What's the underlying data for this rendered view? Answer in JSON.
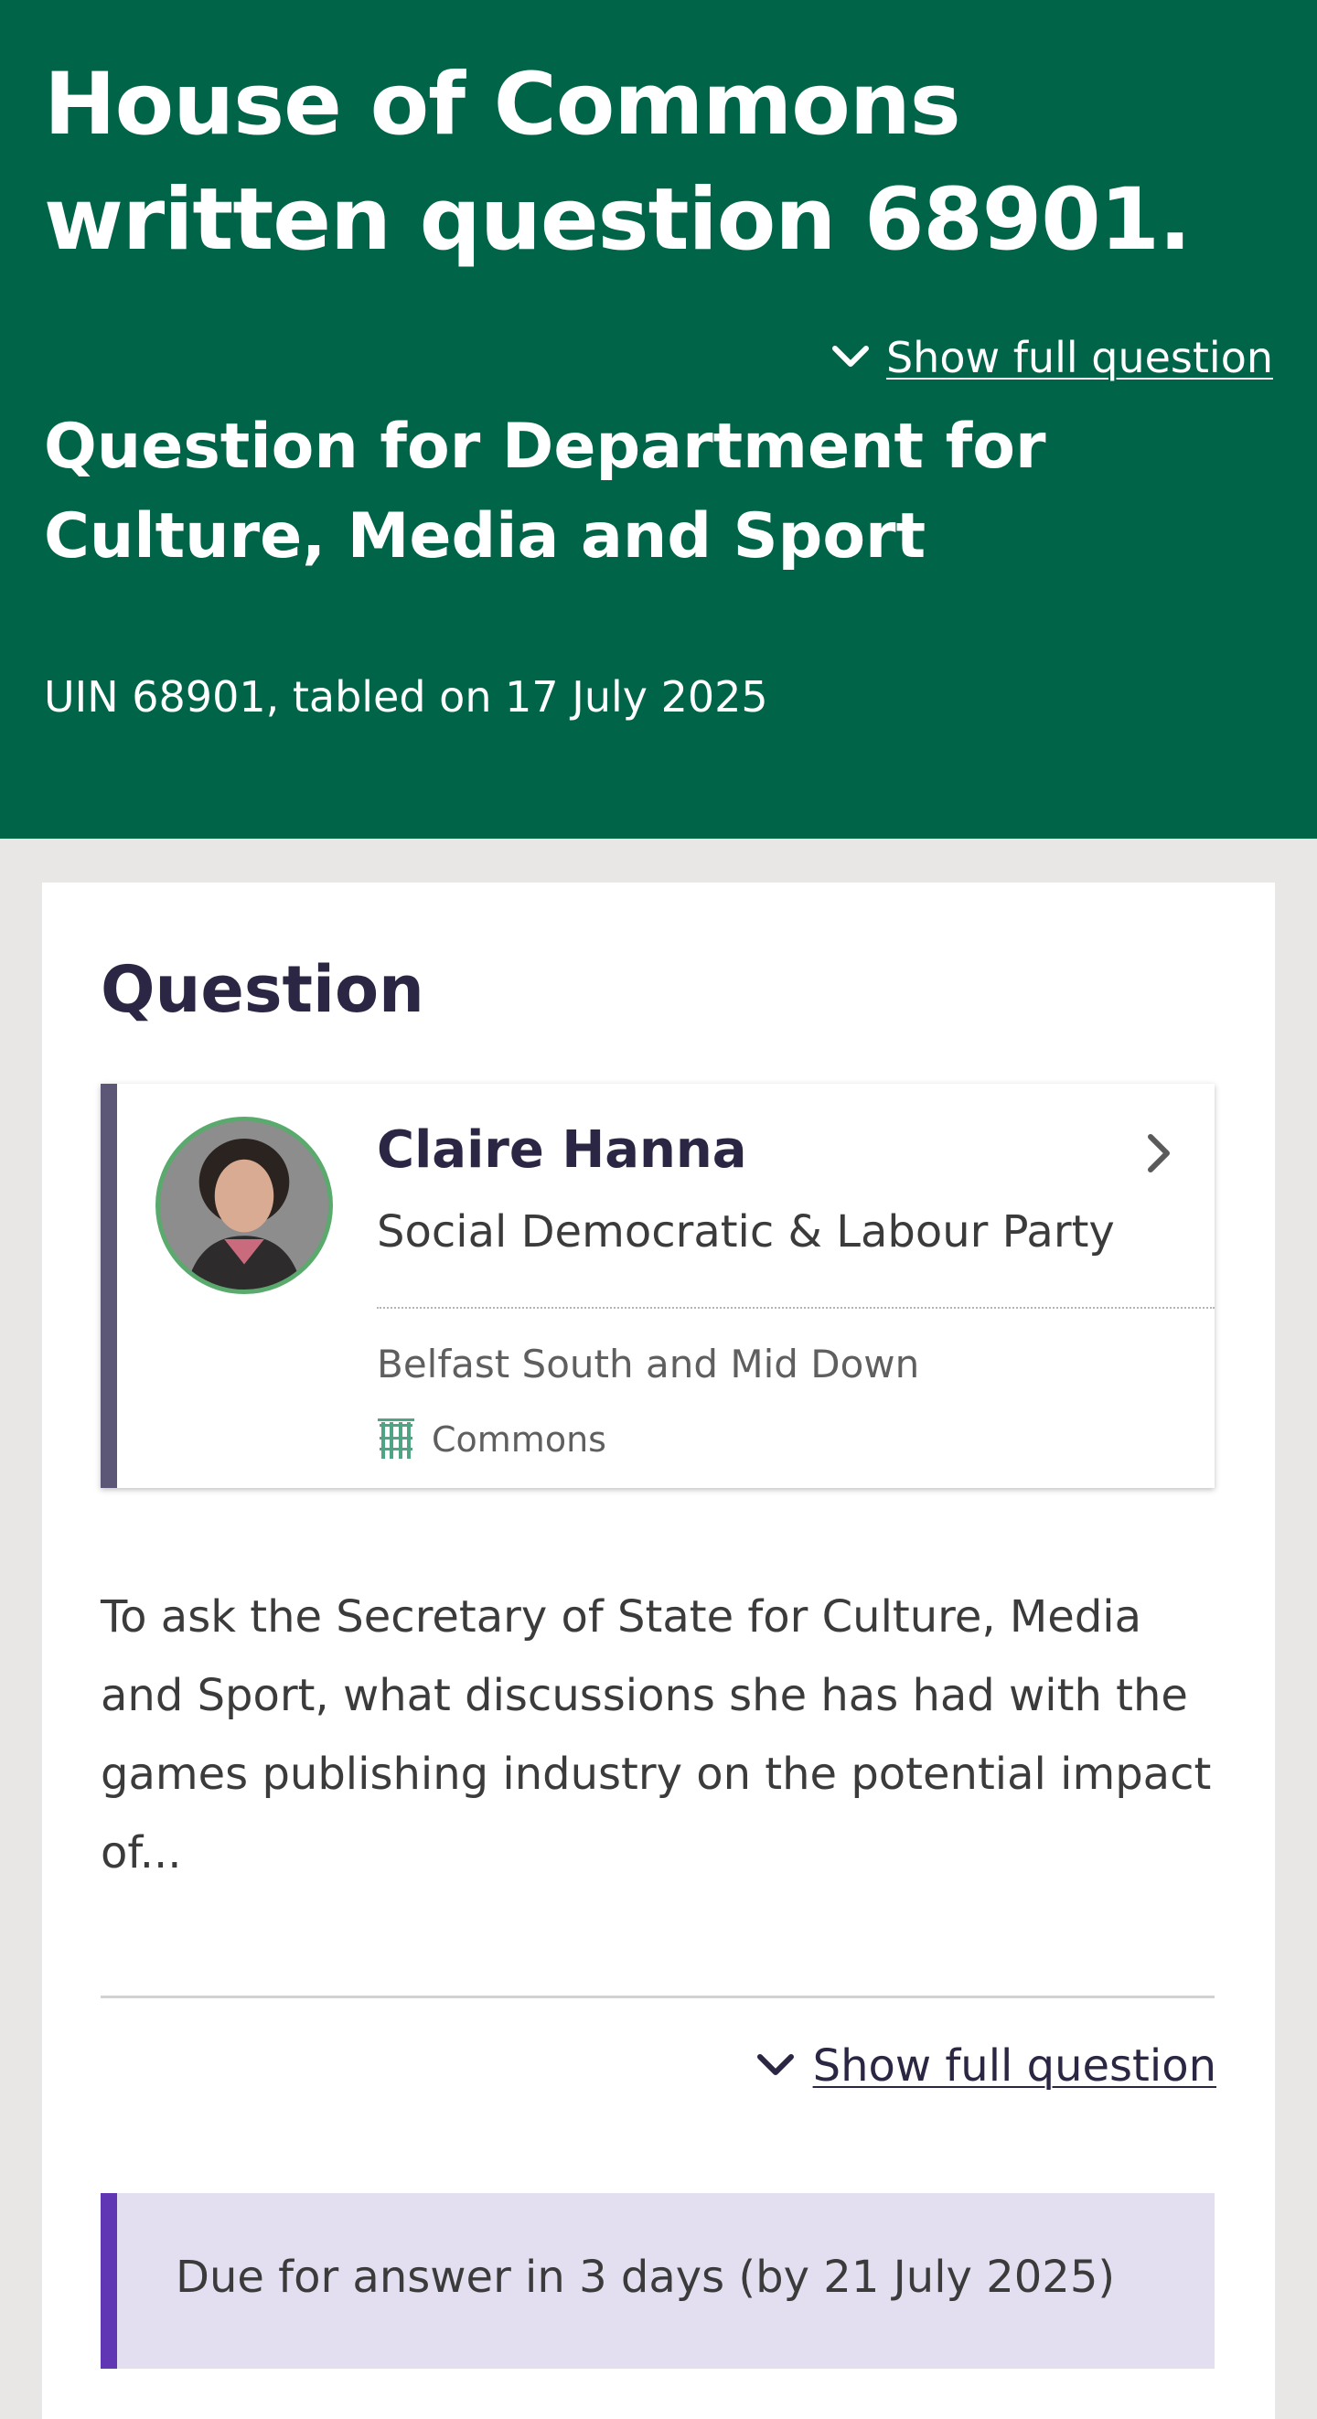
{
  "header": {
    "title": "House of Commons written question 68901.",
    "show_full_label": "Show full question",
    "department": "Question for Department for Culture, Media and Sport",
    "uin_line": "UIN 68901, tabled on 17 July 2025"
  },
  "question": {
    "section_title": "Question",
    "member": {
      "name": "Claire Hanna",
      "party": "Social Democratic & Labour Party",
      "constituency": "Belfast South and Mid Down",
      "house": "Commons"
    },
    "text": "To ask the Secretary of State for Culture, Media and Sport, what discussions she has had with the games publishing industry on the potential impact of...",
    "show_full_label": "Show full question",
    "due_text": "Due for answer in 3 days (by 21 July 2025)"
  },
  "colors": {
    "header_green": "#006548",
    "party_bar": "#5c5677",
    "due_accent": "#6136b5",
    "due_background": "#e3dff0"
  },
  "icons": [
    "chevron-down-icon",
    "chevron-right-icon",
    "portcullis-icon"
  ]
}
